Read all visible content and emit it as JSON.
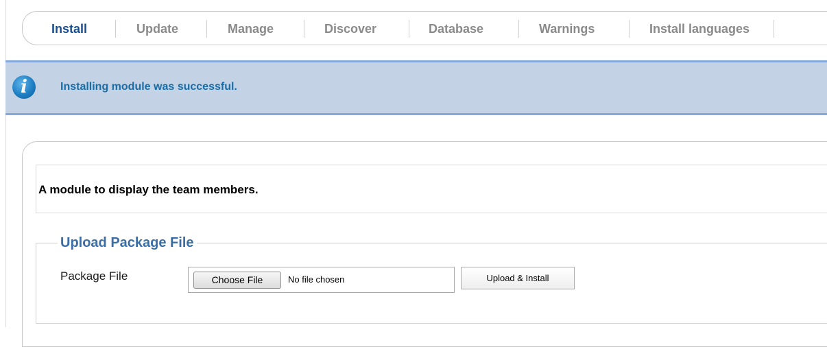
{
  "tabs": [
    {
      "label": "Install",
      "active": true
    },
    {
      "label": "Update",
      "active": false
    },
    {
      "label": "Manage",
      "active": false
    },
    {
      "label": "Discover",
      "active": false
    },
    {
      "label": "Database",
      "active": false
    },
    {
      "label": "Warnings",
      "active": false
    },
    {
      "label": "Install languages",
      "active": false
    }
  ],
  "message": {
    "icon": "info-icon",
    "text": "Installing module was successful."
  },
  "module": {
    "description": "A module to display the team members."
  },
  "upload": {
    "legend": "Upload Package File",
    "field_label": "Package File",
    "choose_label": "Choose File",
    "no_file_text": "No file chosen",
    "submit_label": "Upload & Install"
  },
  "colors": {
    "active_tab": "#1a4d8f",
    "inactive_tab": "#8a8a8a",
    "message_bg": "#c3d2e5",
    "message_border": "#84a7db",
    "message_text": "#1a6ea8",
    "legend_text": "#3a6ea5"
  }
}
